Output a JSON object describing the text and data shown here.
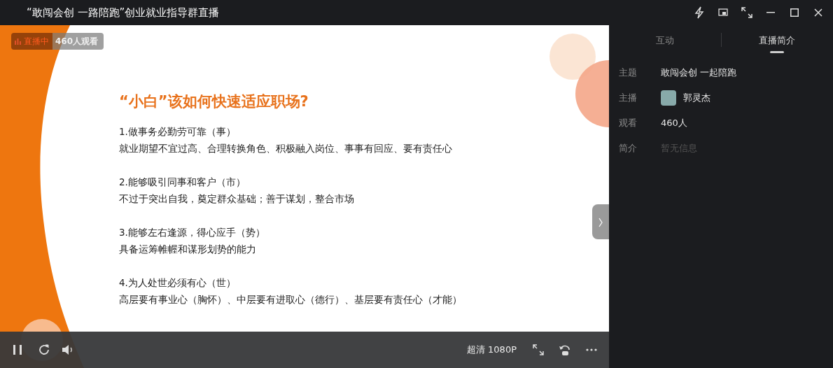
{
  "window": {
    "title": "“敢闯会创 一路陪跑”创业就业指导群直播"
  },
  "live_badge": {
    "status": "直播中",
    "viewers": "460人观看"
  },
  "slide": {
    "title": "“小白”该如何快速适应职场?",
    "sections": [
      {
        "heading": "1.做事务必勤劳可靠（事）",
        "body": "就业期望不宜过高、合理转换角色、积极融入岗位、事事有回应、要有责任心"
      },
      {
        "heading": "2.能够吸引同事和客户（市）",
        "body": "不过于突出自我，奠定群众基础；善于谋划，整合市场"
      },
      {
        "heading": "3.能够左右逢源，得心应手（势）",
        "body": "具备运筹帷幄和谋形划势的能力"
      },
      {
        "heading": "4.为人处世必须有心（世）",
        "body": "高层要有事业心（胸怀）、中层要有进取心（德行）、基层要有责任心（才能）"
      }
    ]
  },
  "player": {
    "playing": true,
    "quality": "超清 1080P"
  },
  "side_panel": {
    "tabs": [
      {
        "label": "互动",
        "selected": false
      },
      {
        "label": "直播简介",
        "selected": true
      }
    ],
    "info": [
      {
        "label": "主题",
        "value": "敢闯会创 一起陪跑",
        "kind": "text"
      },
      {
        "label": "主播",
        "value": "郭灵杰",
        "kind": "host"
      },
      {
        "label": "观看",
        "value": "460人",
        "kind": "text"
      },
      {
        "label": "简介",
        "value": "暂无信息",
        "kind": "empty"
      }
    ]
  }
}
